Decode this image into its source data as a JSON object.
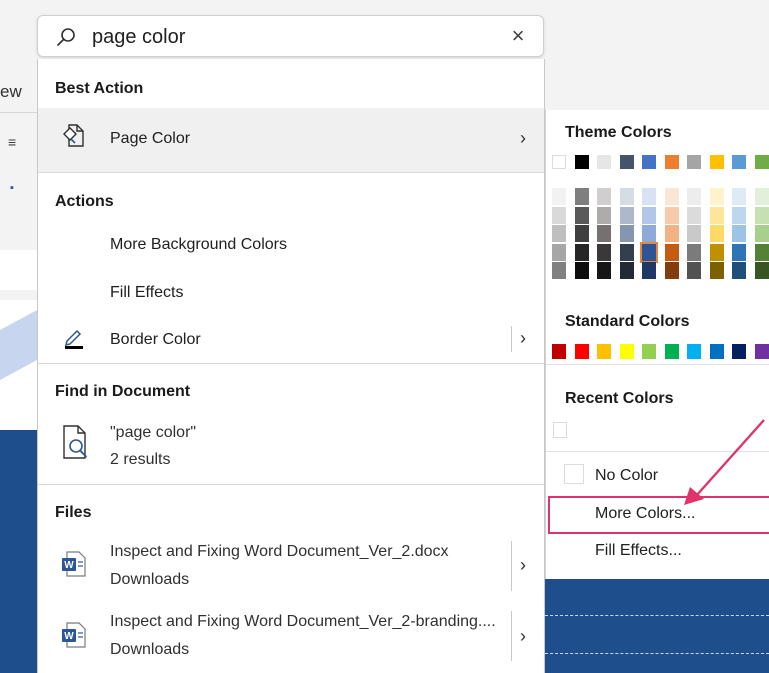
{
  "search": {
    "value": "page color",
    "clear_label": "×"
  },
  "background": {
    "partial_tab_text": "ew"
  },
  "best_action": {
    "title": "Best Action",
    "item_label": "Page Color",
    "item_icon": "page-color-icon"
  },
  "actions": {
    "title": "Actions",
    "items": [
      {
        "label": "More Background Colors"
      },
      {
        "label": "Fill Effects"
      },
      {
        "label": "Border Color",
        "icon": "pencil-icon"
      }
    ]
  },
  "find_in_document": {
    "title": "Find in Document",
    "query": "\"page color\"",
    "results": "2 results"
  },
  "files": {
    "title": "Files",
    "items": [
      {
        "name": "Inspect and Fixing Word Document_Ver_2.docx",
        "location": "Downloads"
      },
      {
        "name": "Inspect and Fixing Word Document_Ver_2-branding....",
        "location": "Downloads"
      }
    ]
  },
  "flyout": {
    "theme_title": "Theme Colors",
    "standard_title": "Standard Colors",
    "recent_title": "Recent Colors",
    "no_color_label": "No Color",
    "more_colors_label": "More Colors...",
    "fill_effects_label": "Fill Effects...",
    "theme_top": [
      "#ffffff",
      "#000000",
      "#e7e6e6",
      "#44546a",
      "#4472c4",
      "#ed7d31",
      "#a5a5a5",
      "#ffc000",
      "#5b9bd5",
      "#70ad47"
    ],
    "theme_shades": [
      [
        "#f2f2f2",
        "#d9d9d9",
        "#bfbfbf",
        "#a6a6a6",
        "#808080"
      ],
      [
        "#7f7f7f",
        "#595959",
        "#3f3f3f",
        "#262626",
        "#0d0d0d"
      ],
      [
        "#d0cece",
        "#aeabab",
        "#757171",
        "#3a3838",
        "#171616"
      ],
      [
        "#d6dce4",
        "#adb9ca",
        "#8496b0",
        "#333f4f",
        "#222a35"
      ],
      [
        "#d9e2f3",
        "#b4c6e7",
        "#8eaadb",
        "#2f5496",
        "#1f3864"
      ],
      [
        "#fbe5d5",
        "#f7cbac",
        "#f4b183",
        "#c55a11",
        "#833c0b"
      ],
      [
        "#ededed",
        "#dbdbdb",
        "#c9c9c9",
        "#7b7b7b",
        "#525252"
      ],
      [
        "#fff2cc",
        "#fee599",
        "#ffd965",
        "#bf9000",
        "#7f6000"
      ],
      [
        "#deebf6",
        "#bdd7ee",
        "#9dc3e6",
        "#2e75b5",
        "#1f4e79"
      ],
      [
        "#e2efd9",
        "#c5e0b3",
        "#a8d08d",
        "#538135",
        "#375623"
      ]
    ],
    "standard": [
      "#c00000",
      "#ff0000",
      "#ffc000",
      "#ffff00",
      "#92d050",
      "#00b050",
      "#00b0f0",
      "#0070c0",
      "#002060",
      "#7030a0"
    ],
    "selected_color": "#2f5496"
  },
  "accent_colors": {
    "highlight": "#e0336b",
    "word_blue": "#2b5797",
    "document_blue": "#1f4e8c"
  }
}
